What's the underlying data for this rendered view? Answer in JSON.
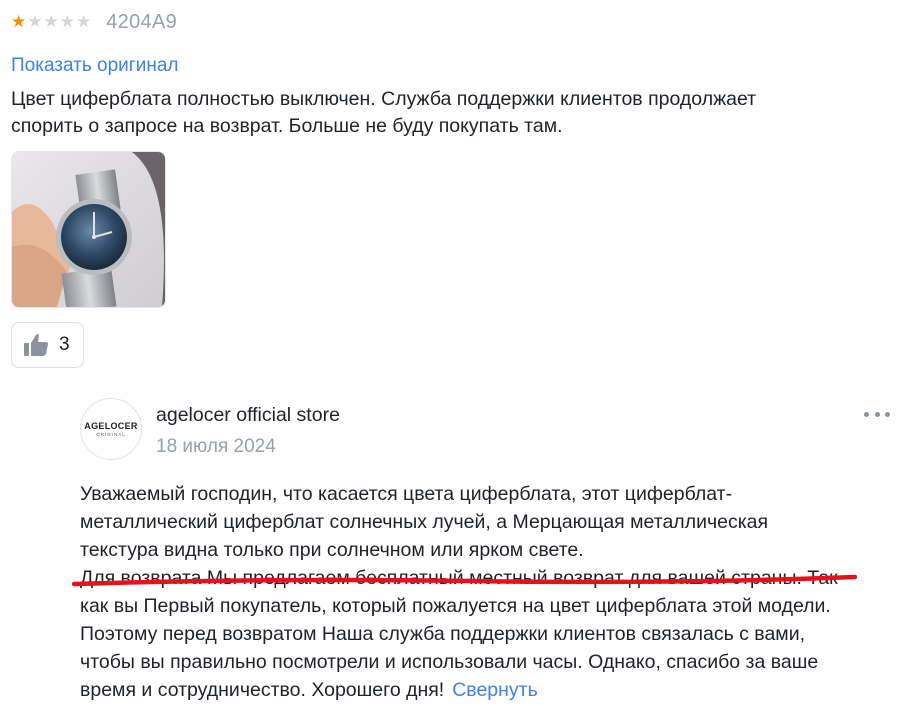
{
  "review": {
    "rating": 1,
    "max_rating": 5,
    "reviewer_name": "4204A9",
    "show_original_label": "Показать оригинал",
    "text_lines": [
      "Цвет циферблата полностью выключен. Служба поддержки клиентов продолжает",
      "спорить о запросе на возврат. Больше не буду покупать там."
    ],
    "like_count": "3"
  },
  "reply": {
    "avatar_brand": "AGELOCER",
    "avatar_sub": "ORIGINAL",
    "store_name": "agelocer official store",
    "date": "18 июля 2024",
    "lines": [
      "Уважаемый господин, что касается цвета циферблата, этот циферблат-",
      "металлический циферблат солнечных лучей, а Мерцающая металлическая",
      "текстура видна только при солнечном или ярком свете.",
      "Для возврата Мы предлагаем бесплатный местный возврат для вашей страны. Так",
      "как вы Первый покупатель, который пожалуется на цвет циферблата этой модели.",
      "Поэтому перед возвратом Наша служба поддержки клиентов связалась с вами,",
      "чтобы вы правильно посмотрели и использовали часы. Однако, спасибо за ваше",
      "время и сотрудничество. Хорошего дня!"
    ],
    "collapse_label": "Свернуть"
  },
  "colors": {
    "star_on": "#f48f13",
    "star_off": "#d3d5d9",
    "link": "#3d82e6",
    "underline_mark": "#e8101a"
  },
  "icons": [
    "star-icon",
    "thumbs-up-icon",
    "more-dots-icon",
    "store-logo"
  ]
}
